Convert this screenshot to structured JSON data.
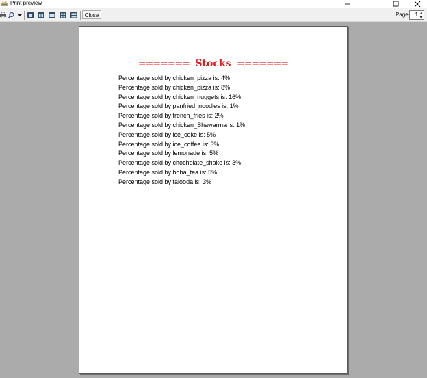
{
  "window": {
    "title": "Print preview"
  },
  "toolbar": {
    "close_label": "Close",
    "page_label": "Page",
    "page_value": "1"
  },
  "document": {
    "title_deco_left": "=======",
    "title_word": "Stocks",
    "title_deco_right": "=======",
    "title_color": "#e01818",
    "lines": [
      "Percentage sold by chicken_pizza is: 4%",
      "Percentage sold by chicken_pizza is: 8%",
      "Percentage sold by chicken_nuggets is: 16%",
      "Percentage sold by panfried_noodles is: 1%",
      "Percentage sold by french_fries is: 2%",
      "Percentage sold by chicken_Shawarma is: 1%",
      "Percentage sold by ice_coke is: 5%",
      "Percentage sold by ice_coffee is: 3%",
      "Percentage sold by lemonade is: 5%",
      "Percentage sold by chocholate_shake is: 3%",
      "Percentage sold by boba_tea is: 5%",
      "Percentage sold by falooda is: 3%"
    ]
  }
}
